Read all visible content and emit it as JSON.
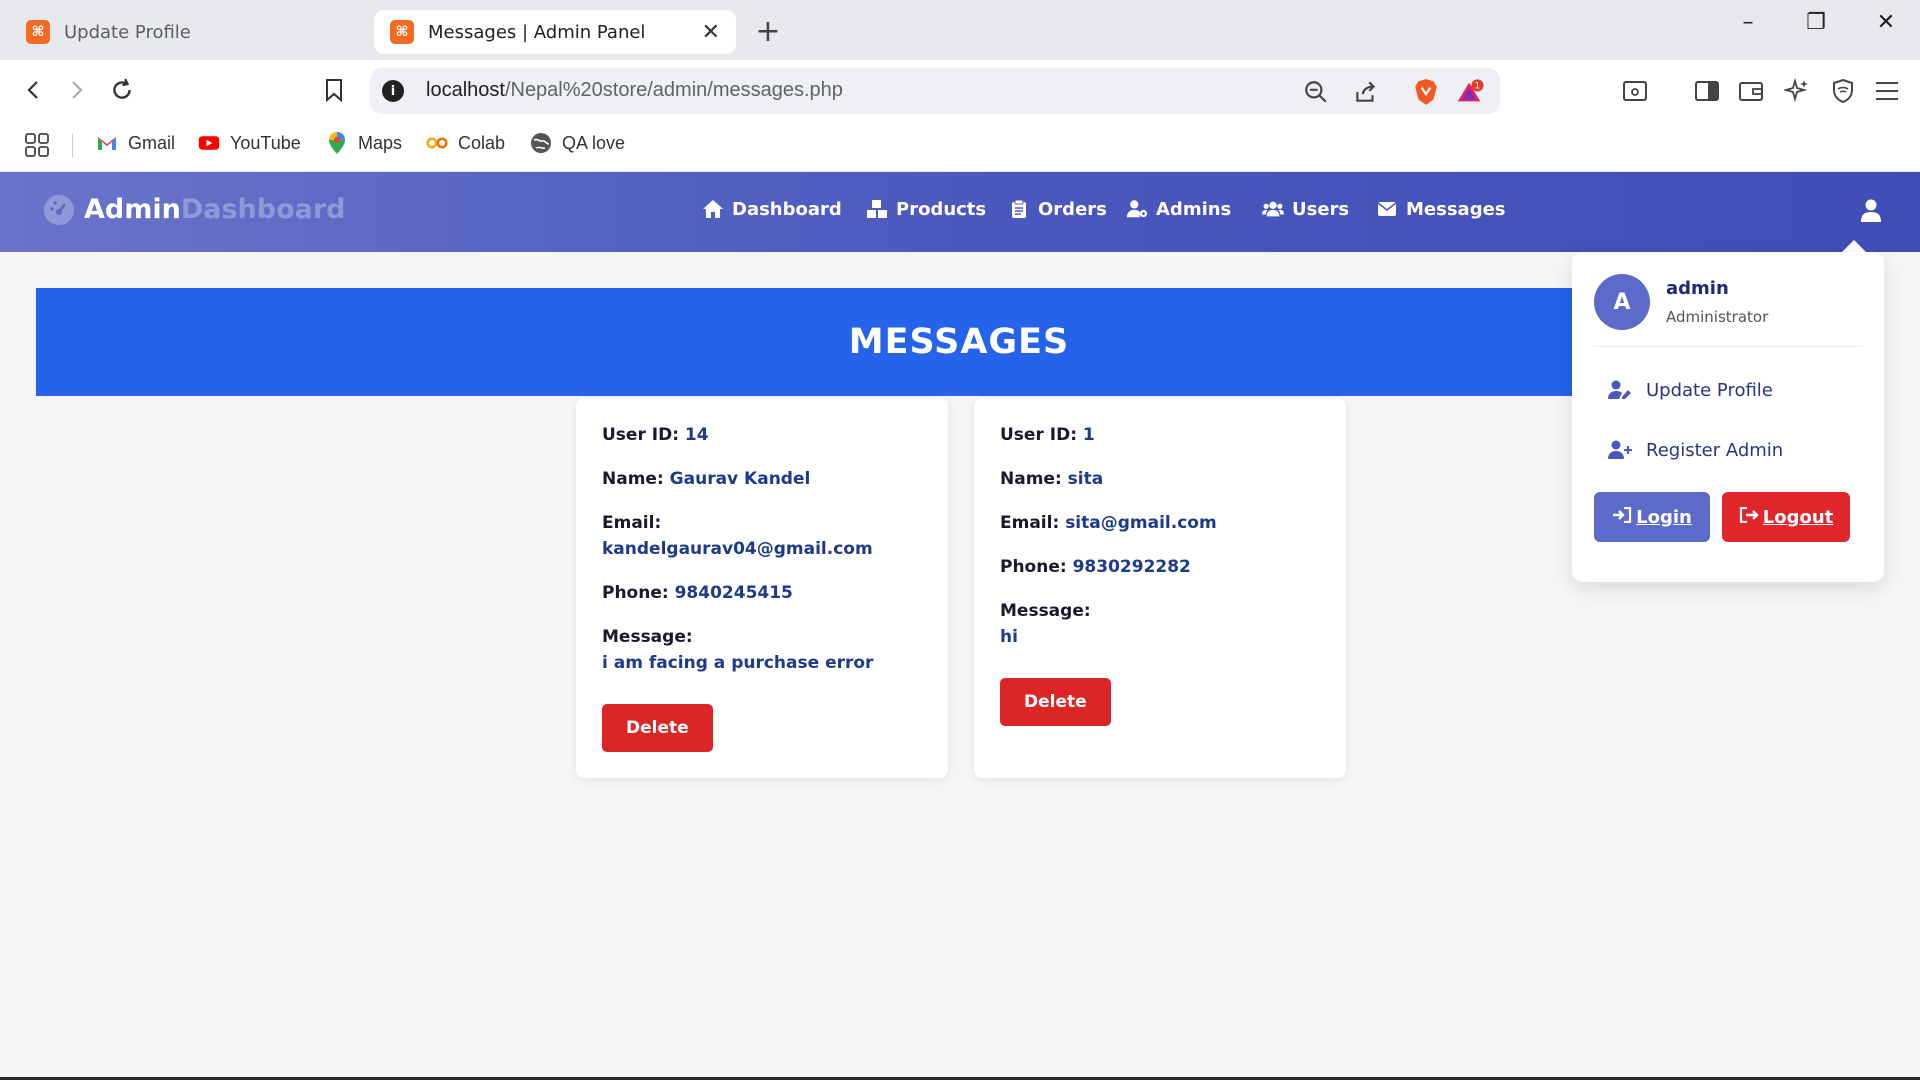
{
  "browser": {
    "tabs": [
      {
        "title": "Update Profile",
        "favicon": "xampp-icon",
        "active": false
      },
      {
        "title": "Messages | Admin Panel",
        "favicon": "xampp-icon",
        "active": true
      }
    ],
    "url": {
      "host": "localhost",
      "path": "/Nepal%20store/admin/messages.php"
    },
    "brave_badge": "1",
    "bookmarks": [
      {
        "label": "Gmail",
        "icon": "gmail-icon"
      },
      {
        "label": "YouTube",
        "icon": "youtube-icon"
      },
      {
        "label": "Maps",
        "icon": "maps-icon"
      },
      {
        "label": "Colab",
        "icon": "colab-icon"
      },
      {
        "label": "QA love",
        "icon": "globe-icon"
      }
    ]
  },
  "header": {
    "brand_primary": "Admin",
    "brand_secondary": "Dashboard",
    "nav": [
      {
        "label": "Dashboard",
        "icon": "home-icon"
      },
      {
        "label": "Products",
        "icon": "boxes-icon"
      },
      {
        "label": "Orders",
        "icon": "clipboard-icon"
      },
      {
        "label": "Admins",
        "icon": "user-gear-icon"
      },
      {
        "label": "Users",
        "icon": "users-icon"
      },
      {
        "label": "Messages",
        "icon": "envelope-icon"
      }
    ]
  },
  "page": {
    "title": "MESSAGES"
  },
  "labels": {
    "user_id": "User ID:",
    "name": "Name:",
    "email": "Email:",
    "phone": "Phone:",
    "message": "Message:",
    "delete": "Delete"
  },
  "messages": [
    {
      "user_id": "14",
      "name": "Gaurav Kandel",
      "email": "kandelgaurav04@gmail.com",
      "phone": "9840245415",
      "message": "i am facing a purchase error"
    },
    {
      "user_id": "1",
      "name": "sita",
      "email": "sita@gmail.com",
      "phone": "9830292282",
      "message": "hi"
    }
  ],
  "dropdown": {
    "avatar_letter": "A",
    "name": "admin",
    "role": "Administrator",
    "update_profile": "Update Profile",
    "register_admin": "Register Admin",
    "login": "Login",
    "logout": "Logout"
  },
  "colors": {
    "header_gradient": [
      "#6a74c9",
      "#3f4db6"
    ],
    "banner": "#2563eb",
    "delete": "#dc2626",
    "login": "#5c6bc9",
    "logout": "#e0262b",
    "value_text": "#1e3a8a"
  }
}
